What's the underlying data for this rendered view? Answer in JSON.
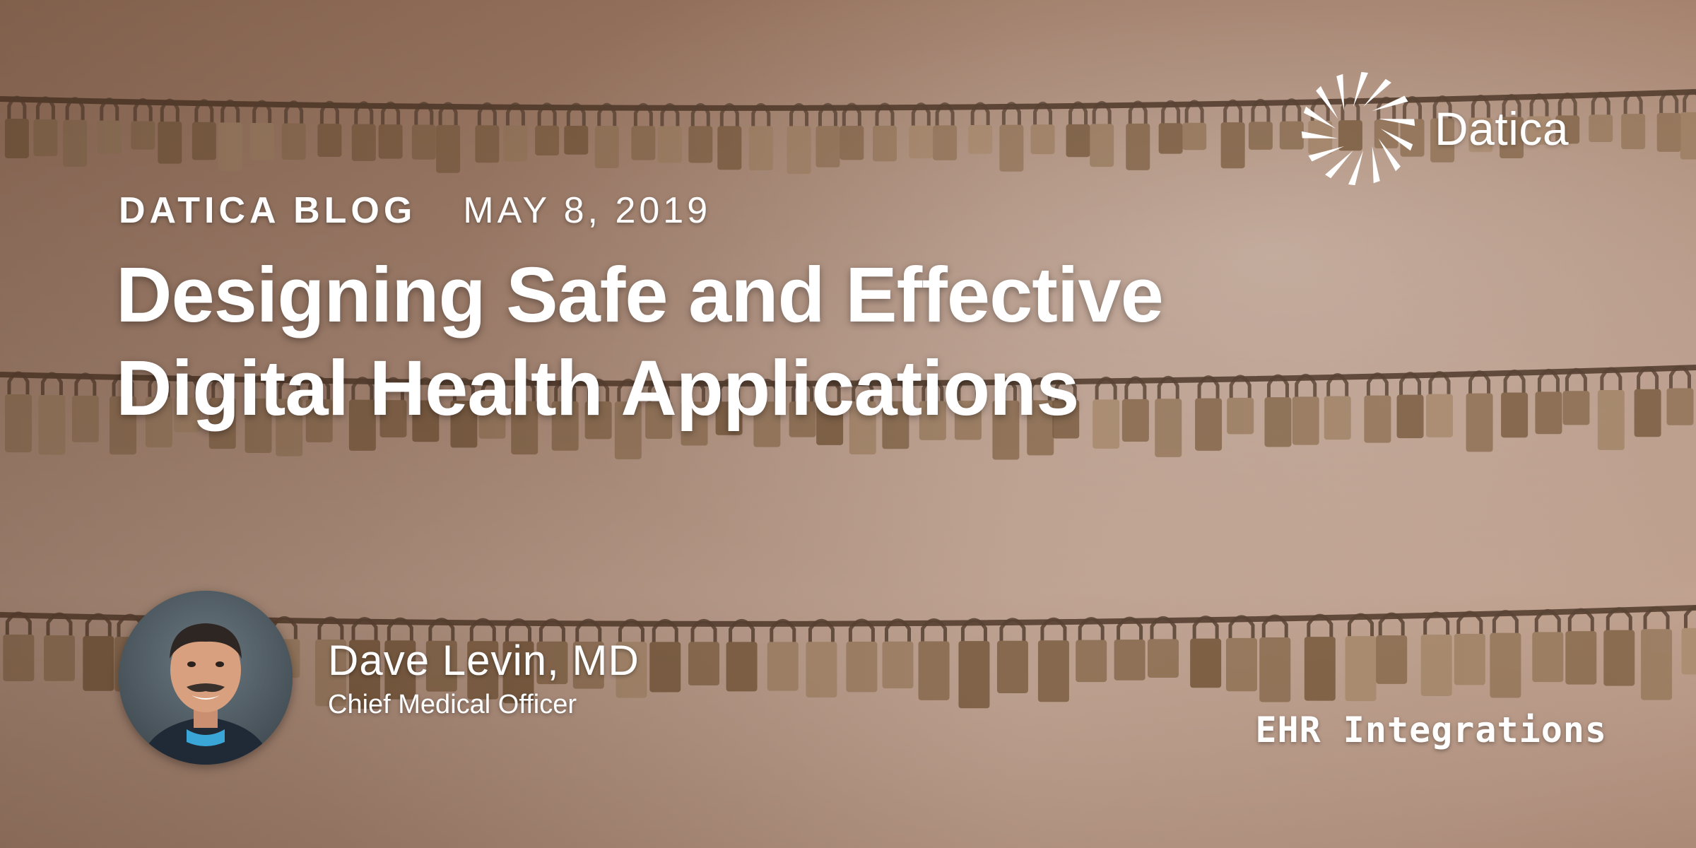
{
  "brand": {
    "name": "Datica",
    "logo_icon": "datica-starburst-icon",
    "color": "#ffffff"
  },
  "header": {
    "section": "DATICA BLOG",
    "date": "MAY 8, 2019"
  },
  "post": {
    "title": "Designing Safe and Effective Digital Health Applications"
  },
  "author": {
    "name": "Dave Levin, MD",
    "role": "Chief Medical Officer"
  },
  "category": {
    "label": "EHR Integrations"
  },
  "background": {
    "subject": "padlocks-on-cables-photo",
    "tint": "#a5806a"
  }
}
